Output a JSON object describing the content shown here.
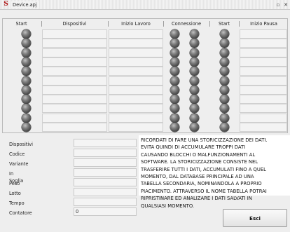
{
  "window": {
    "title": "Device.apj",
    "app_icon_letter": "S",
    "restore_glyph": "▫",
    "close_glyph": "✕"
  },
  "grid": {
    "headers": [
      "Start",
      "Dispositivi",
      "Inizio Lavoro",
      "Connessione",
      "Start",
      "Inizio Pausa"
    ],
    "row_count": 11
  },
  "form": {
    "labels": [
      "Dispositivi",
      "Codice",
      "Variante",
      "In Soglia",
      "Peso",
      "Lotto",
      "Tempo",
      "Contatore"
    ],
    "values": [
      "",
      "",
      "",
      "",
      "",
      "",
      "",
      "0"
    ]
  },
  "notes": {
    "lines": [
      "RICORDATI DI FARE UNA STORICIZZAZIONE DEI DATI.",
      "EVITA QUINDI DI ACCUMULARE TROPPI DATI",
      "CAUSANDO BLOCCHI O MALFUNZIONAMENTI AL",
      "SOFTWARE. LA STORICIZZAZIONE CONSISTE NEL",
      "TRASFERIRE TUTTI I DATI, ACCUMULATI FINO A QUEL",
      "MOMENTO, DAL DATABASE PRINCIPALE AD UNA",
      "TABELLA SECONDARIA, NOMINANDOLA A PROPRIO",
      "PIACIMENTO. ATTRAVERSO IL NOME TABELLA POTRAI",
      "RIPRISTINARE ED ANALIZARE I DATI SALVATI IN",
      "QUALSIASI MOMENTO."
    ]
  },
  "buttons": {
    "exit_label": "Esci"
  }
}
